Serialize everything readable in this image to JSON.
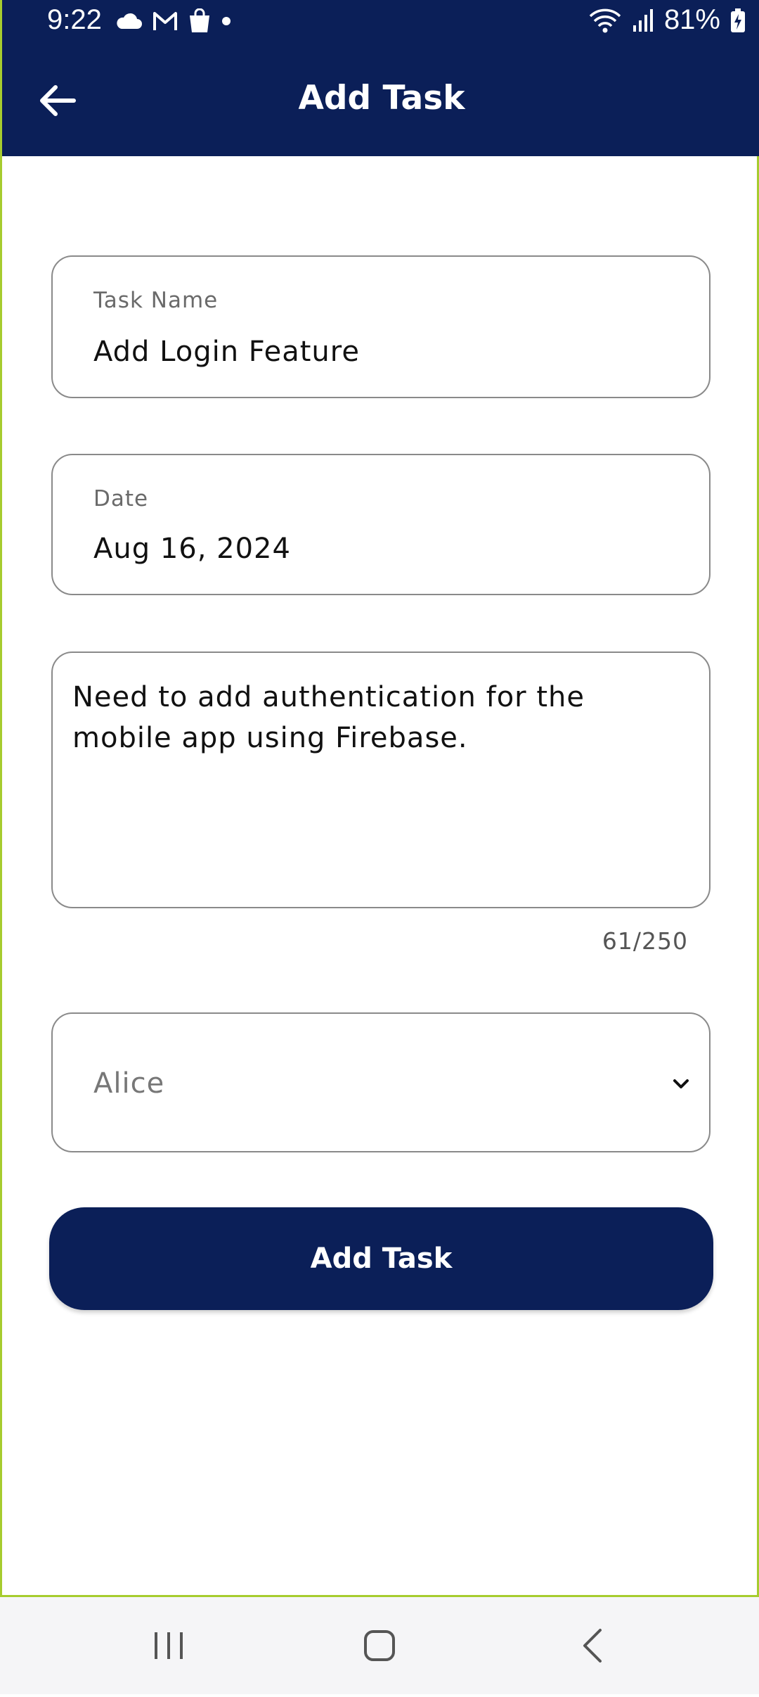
{
  "status_bar": {
    "time": "9:22",
    "battery": "81%",
    "left_icons": [
      "cloud-icon",
      "gmail-icon",
      "shopping-bag-icon",
      "dot-icon"
    ],
    "right_icons": [
      "wifi-icon",
      "signal-icon",
      "battery-charging-icon"
    ]
  },
  "app_bar": {
    "title": "Add Task",
    "back_icon": "arrow-left-icon",
    "background": "#0b1f58"
  },
  "form": {
    "task_name": {
      "label": "Task Name",
      "value": "Add Login Feature"
    },
    "date": {
      "label": "Date",
      "value": "Aug 16, 2024"
    },
    "description": {
      "value": "Need to add authentication for the mobile app using Firebase.",
      "counter": "61/250"
    },
    "assignee": {
      "selected": "Alice",
      "icon": "chevron-down-icon"
    },
    "submit_label": "Add Task"
  },
  "nav_bar": {
    "buttons": [
      "recent-apps-icon",
      "home-icon",
      "back-icon"
    ]
  },
  "colors": {
    "primary": "#0b1f58",
    "frame_border": "#a6cc2e",
    "field_border": "#8a8a8a"
  }
}
